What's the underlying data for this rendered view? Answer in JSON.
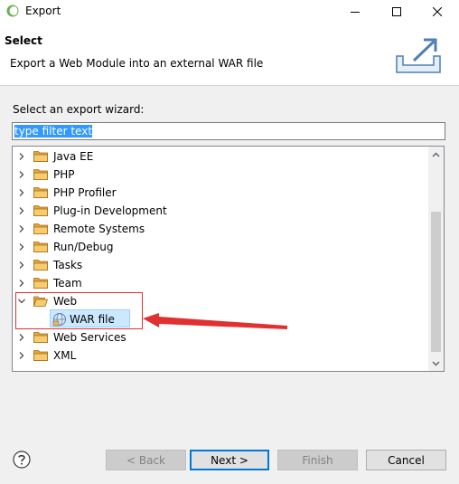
{
  "window": {
    "title": "Export"
  },
  "header": {
    "title": "Select",
    "description": "Export a Web Module into an external WAR file"
  },
  "wizard": {
    "label": "Select an export wizard:",
    "filter_value": "type filter text"
  },
  "tree": {
    "items": [
      {
        "label": "Java EE",
        "expanded": false
      },
      {
        "label": "PHP",
        "expanded": false
      },
      {
        "label": "PHP Profiler",
        "expanded": false
      },
      {
        "label": "Plug-in Development",
        "expanded": false
      },
      {
        "label": "Remote Systems",
        "expanded": false
      },
      {
        "label": "Run/Debug",
        "expanded": false
      },
      {
        "label": "Tasks",
        "expanded": false
      },
      {
        "label": "Team",
        "expanded": false
      },
      {
        "label": "Web",
        "expanded": true,
        "children": [
          {
            "label": "WAR file",
            "selected": true
          }
        ]
      },
      {
        "label": "Web Services",
        "expanded": false
      },
      {
        "label": "XML",
        "expanded": false
      }
    ]
  },
  "buttons": {
    "back": "< Back",
    "next": "Next >",
    "finish": "Finish",
    "cancel": "Cancel"
  },
  "colors": {
    "selection": "#cce8ff",
    "folder": "#e8a33d",
    "annotation": "#e03030",
    "default_button_border": "#0078d7"
  }
}
